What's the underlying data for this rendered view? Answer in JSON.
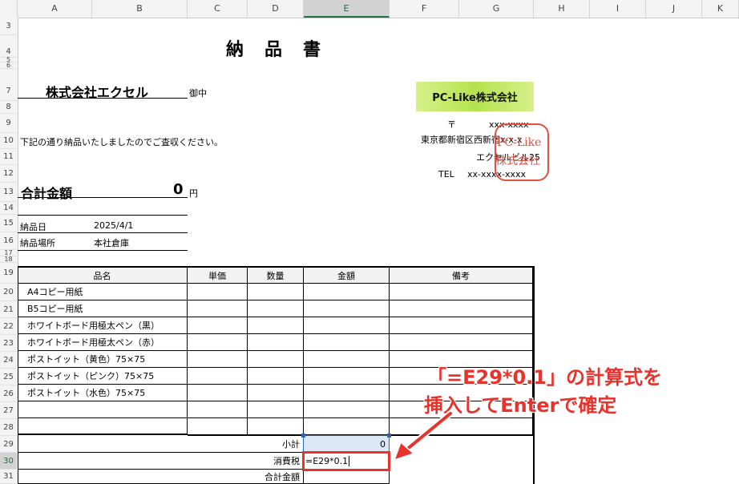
{
  "columns": [
    "A",
    "B",
    "C",
    "D",
    "E",
    "F",
    "G",
    "H",
    "I",
    "J",
    "K"
  ],
  "rows": [
    "3",
    "4",
    "5",
    "6",
    "7",
    "8",
    "9",
    "10",
    "11",
    "12",
    "13",
    "14",
    "15",
    "16",
    "17",
    "18",
    "19",
    "20",
    "21",
    "22",
    "23",
    "24",
    "25",
    "26",
    "27",
    "28",
    "29",
    "30",
    "31"
  ],
  "title": "納　品　書",
  "recipient": {
    "company": "株式会社エクセル",
    "honorific": "御中"
  },
  "intro": "下記の通り納品いたしましたのでご査収ください。",
  "total": {
    "label": "合計金額",
    "value": "0",
    "unit": "円"
  },
  "delivery_date": {
    "label": "納品日",
    "value": "2025/4/1"
  },
  "delivery_place": {
    "label": "納品場所",
    "value": "本社倉庫"
  },
  "sender": {
    "logo_text": "PC-Like株式会社",
    "postal_mark": "〒",
    "postal_code": "xxx-xxxx",
    "address1": "東京都新宿区西新宿x-x-x",
    "address2": "エクセルビル25",
    "tel_label": "TEL",
    "tel": "xx-xxxx-xxxx",
    "seal_line1": "PC-Like",
    "seal_line2": "株式会社"
  },
  "table": {
    "headers": [
      "品名",
      "単価",
      "数量",
      "金額",
      "備考"
    ],
    "items": [
      "A4コピー用紙",
      "B5コピー用紙",
      "ホワイトボード用極太ペン（黒）",
      "ホワイトボード用極太ペン（赤）",
      "ポストイット（黄色）75×75",
      "ポストイット（ピンク）75×75",
      "ポストイット（水色）75×75",
      "",
      ""
    ]
  },
  "summary": {
    "subtotal_label": "小計",
    "subtotal_value": "0",
    "tax_label": "消費税",
    "tax_formula": "=E29*0.1",
    "grand_label": "合計金額"
  },
  "annotation": {
    "line1": "「=E29*0.1」の計算式を",
    "line2": "挿入してEnterで確定",
    "color": "#e8322c"
  },
  "colors": {
    "accent": "#217346",
    "seal": "#e05040",
    "logo_bg": "#c6ee6a"
  }
}
